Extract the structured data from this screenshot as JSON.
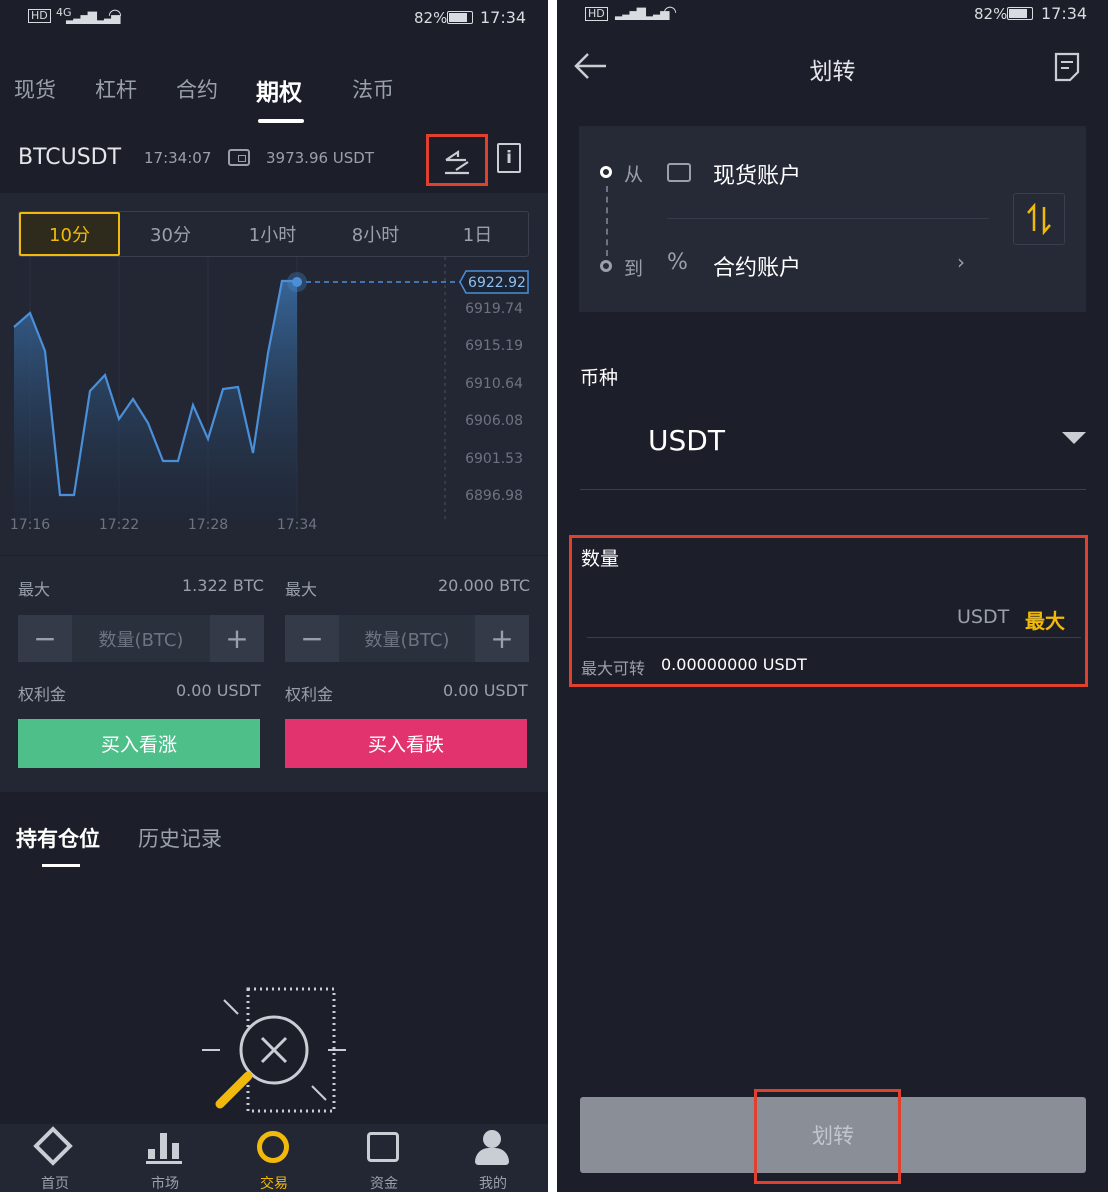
{
  "colors": {
    "bg": "#1c1f29",
    "panel": "#232734",
    "accent": "#f0b90b",
    "green": "#4fbf8a",
    "pink": "#e2336f",
    "highlight": "#e0402c"
  },
  "status_left": {
    "signal": "4G",
    "battery": "82%",
    "time": "17:34"
  },
  "status_right": {
    "battery": "82%",
    "time": "17:34"
  },
  "left": {
    "tabs": [
      "现货",
      "杠杆",
      "合约",
      "期权",
      "法币"
    ],
    "active_tab": "期权",
    "symbol": "BTCUSDT",
    "time": "17:34:07",
    "balance": "3973.96 USDT",
    "intervals": [
      "10分",
      "30分",
      "1小时",
      "8小时",
      "1日"
    ],
    "active_interval": "10分",
    "chart_data": {
      "type": "area",
      "x": [
        "17:16",
        "17:22",
        "17:28",
        "17:34"
      ],
      "y_ticks": [
        "6919.74",
        "6915.19",
        "6910.64",
        "6906.08",
        "6901.53",
        "6896.98"
      ],
      "last_price": "6922.92"
    },
    "buy_call": {
      "max_label": "最大",
      "max_value": "1.322 BTC",
      "qty_placeholder": "数量(BTC)",
      "premium_label": "权利金",
      "premium_value": "0.00 USDT",
      "button": "买入看涨",
      "minus": "−",
      "plus": "+"
    },
    "buy_put": {
      "max_label": "最大",
      "max_value": "20.000 BTC",
      "qty_placeholder": "数量(BTC)",
      "premium_label": "权利金",
      "premium_value": "0.00 USDT",
      "button": "买入看跌",
      "minus": "−",
      "plus": "+"
    },
    "pos_tabs": [
      "持有仓位",
      "历史记录"
    ],
    "nav": [
      "首页",
      "市场",
      "交易",
      "资金",
      "我的"
    ],
    "active_nav": "交易"
  },
  "right": {
    "title": "划转",
    "from_label": "从",
    "from_account": "现货账户",
    "to_label": "到",
    "to_account": "合约账户",
    "to_icon": "%",
    "currency_label": "币种",
    "currency_value": "USDT",
    "amount_label": "数量",
    "amount_unit": "USDT",
    "max_button": "最大",
    "max_transfer_label": "最大可转",
    "max_transfer_value": "0.00000000  USDT",
    "submit": "划转"
  }
}
